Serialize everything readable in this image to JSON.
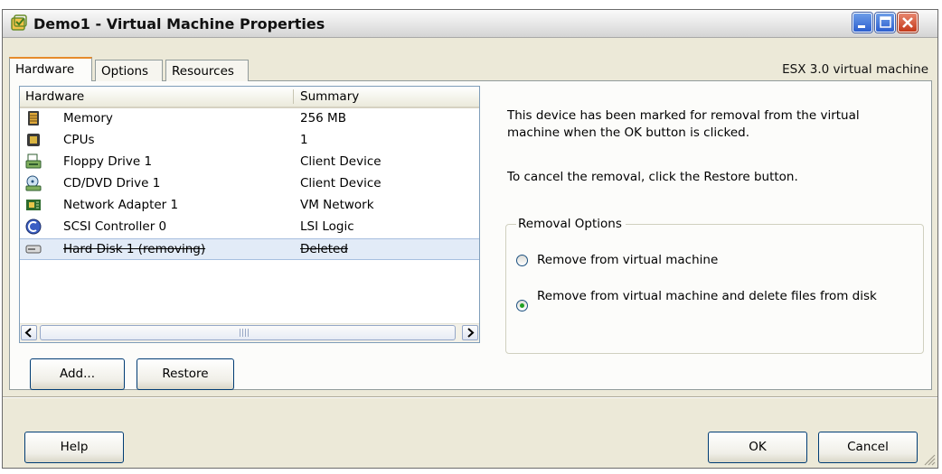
{
  "window": {
    "title": "Demo1 - Virtual Machine Properties",
    "icons": [
      "vm-icon",
      "minimize-icon",
      "maximize-icon",
      "close-icon"
    ],
    "close_color": "#d9472b",
    "accent": "#e68b2c"
  },
  "tabs": [
    {
      "label": "Hardware",
      "active": true
    },
    {
      "label": "Options",
      "active": false
    },
    {
      "label": "Resources",
      "active": false
    }
  ],
  "vm_version": "ESX 3.0 virtual machine",
  "hardware_list": {
    "columns": [
      "Hardware",
      "Summary"
    ],
    "rows": [
      {
        "name": "Memory",
        "summary": "256 MB",
        "icon": "memory-icon"
      },
      {
        "name": "CPUs",
        "summary": "1",
        "icon": "cpu-icon"
      },
      {
        "name": "Floppy Drive 1",
        "summary": "Client Device",
        "icon": "floppy-icon"
      },
      {
        "name": "CD/DVD Drive 1",
        "summary": "Client Device",
        "icon": "cdrom-icon"
      },
      {
        "name": "Network Adapter 1",
        "summary": "VM Network",
        "icon": "network-adapter-icon"
      },
      {
        "name": "SCSI Controller 0",
        "summary": "LSI Logic",
        "icon": "scsi-icon"
      },
      {
        "name": "Hard Disk 1 (removing)",
        "summary": "Deleted",
        "icon": "hard-disk-icon",
        "selected": true,
        "struck": true
      }
    ]
  },
  "buttons": {
    "add": "Add...",
    "restore": "Restore",
    "help": "Help",
    "ok": "OK",
    "cancel": "Cancel"
  },
  "info": {
    "removal_note": "This device has been marked for removal from the virtual machine when the OK button is clicked.",
    "cancel_note": "To cancel the removal, click the Restore button."
  },
  "removal_options": {
    "legend": "Removal Options",
    "options": [
      {
        "label": "Remove from virtual machine",
        "checked": false
      },
      {
        "label": "Remove from virtual machine and delete files from disk",
        "checked": true
      }
    ]
  }
}
